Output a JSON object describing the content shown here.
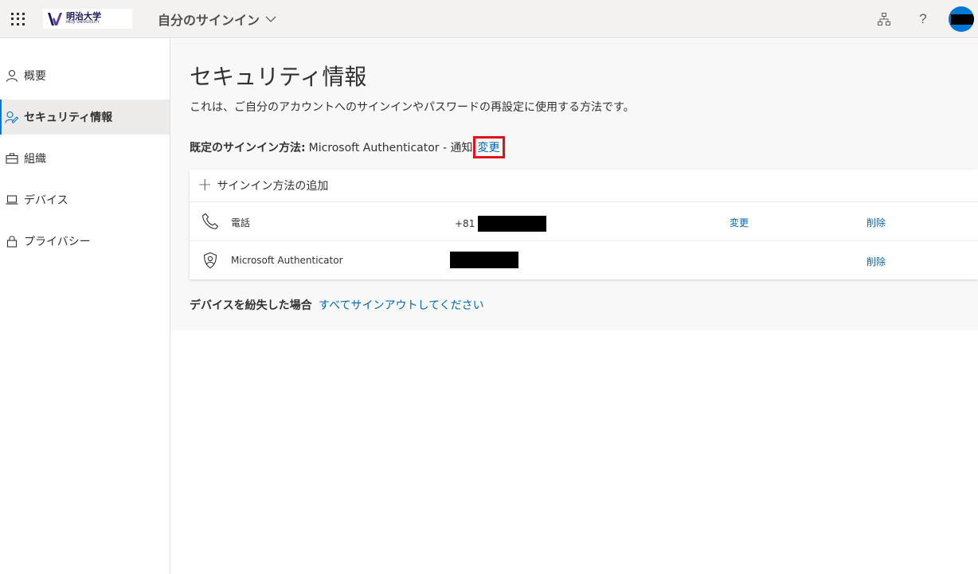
{
  "header": {
    "logo_text_jp": "明治大学",
    "logo_text_en": "MEIJI UNIVERSITY",
    "app_title": "自分のサインイン",
    "help_glyph": "?"
  },
  "sidebar": {
    "items": [
      {
        "label": "概要",
        "icon": "person-icon",
        "active": false
      },
      {
        "label": "セキュリティ情報",
        "icon": "security-info-icon",
        "active": true
      },
      {
        "label": "組織",
        "icon": "briefcase-icon",
        "active": false
      },
      {
        "label": "デバイス",
        "icon": "laptop-icon",
        "active": false
      },
      {
        "label": "プライバシー",
        "icon": "lock-icon",
        "active": false
      }
    ]
  },
  "main": {
    "title": "セキュリティ情報",
    "description": "これは、ご自分のアカウントへのサインインやパスワードの再設定に使用する方法です。",
    "default_method_label": "既定のサインイン方法:",
    "default_method_value": "Microsoft Authenticator - 通知",
    "default_method_change": "変更",
    "add_method_label": "サインイン方法の追加",
    "methods": [
      {
        "name": "電話",
        "icon": "phone-icon",
        "value_prefix": "+81",
        "change": "変更",
        "delete": "削除"
      },
      {
        "name": "Microsoft Authenticator",
        "icon": "authenticator-icon",
        "value_prefix": "",
        "change": "",
        "delete": "削除"
      }
    ],
    "lost_device_label": "デバイスを紛失した場合",
    "lost_device_link": "すべてサインアウトしてください"
  },
  "colors": {
    "accent": "#0078d4",
    "link": "#0067b8",
    "highlight_box": "#e3101e"
  }
}
